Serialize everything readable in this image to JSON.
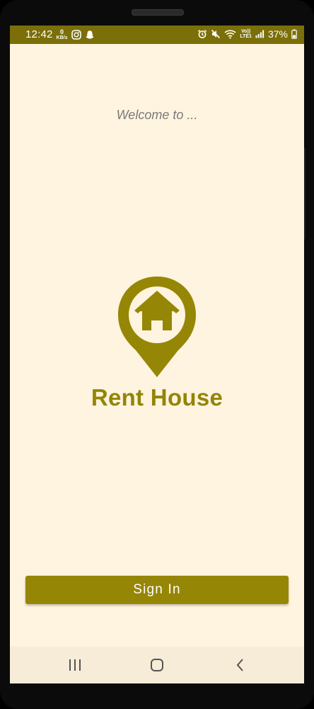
{
  "status_bar": {
    "time": "12:42",
    "data_rate_value": "0",
    "data_rate_unit": "KB/s",
    "battery_percent": "37%",
    "icons": [
      "instagram-icon",
      "snapchat-icon",
      "alarm-icon",
      "mute-icon",
      "wifi-icon",
      "volte-icon",
      "signal-icon",
      "battery-icon"
    ],
    "volte_label": "Vo))",
    "lte_label": "LTE1"
  },
  "screen": {
    "welcome_text": "Welcome to ...",
    "logo_icon": "house-location-pin-icon",
    "app_name": "Rent House",
    "sign_in_label": "Sign In"
  },
  "nav_bar": {
    "items": [
      "recents-icon",
      "home-icon",
      "back-icon"
    ]
  },
  "colors": {
    "status_bar": "#7a6f08",
    "accent": "#968605",
    "background": "#fff4df",
    "welcome_text": "#7a7a7a",
    "nav_bar": "#f7ecd8"
  }
}
